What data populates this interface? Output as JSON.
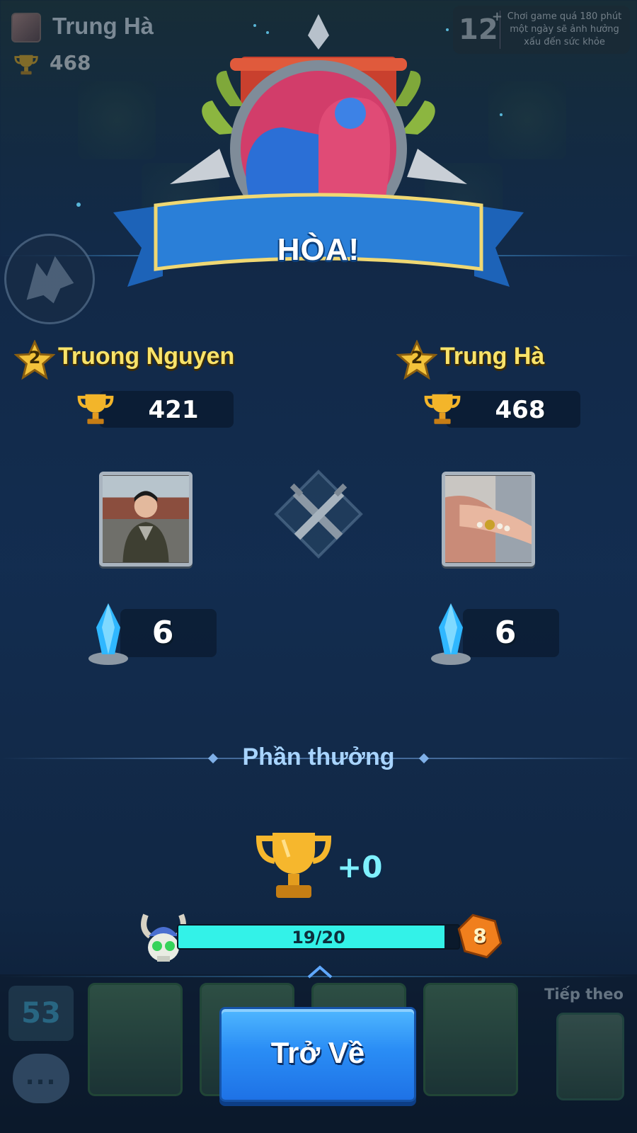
{
  "hud": {
    "player_name": "Trung Hà",
    "trophies": "468",
    "age_rating": "12",
    "age_plus": "+",
    "health_warning": "Chơi game quá 180 phút một ngày sẽ ảnh hưởng xấu đến sức khỏe"
  },
  "result": {
    "title": "HÒA!"
  },
  "players": [
    {
      "level": "2",
      "name": "Truong Nguyen",
      "trophies": "421",
      "crowns": "6"
    },
    {
      "level": "2",
      "name": "Trung Hà",
      "trophies": "468",
      "crowns": "6"
    }
  ],
  "rewards": {
    "label": "Phần thưởng",
    "trophy_delta": "+0"
  },
  "progress": {
    "text": "19/20",
    "current": 19,
    "max": 20,
    "level": "8"
  },
  "deck": {
    "elixir": "53",
    "next_label": "Tiếp theo",
    "chat_label": "..."
  },
  "actions": {
    "back_label": "Trở Về"
  },
  "colors": {
    "player_name": "#f8e36a",
    "progress_fill": "#33f2e8",
    "button_blue": "#2a8df5",
    "rewards_label": "#a8d4ff"
  }
}
